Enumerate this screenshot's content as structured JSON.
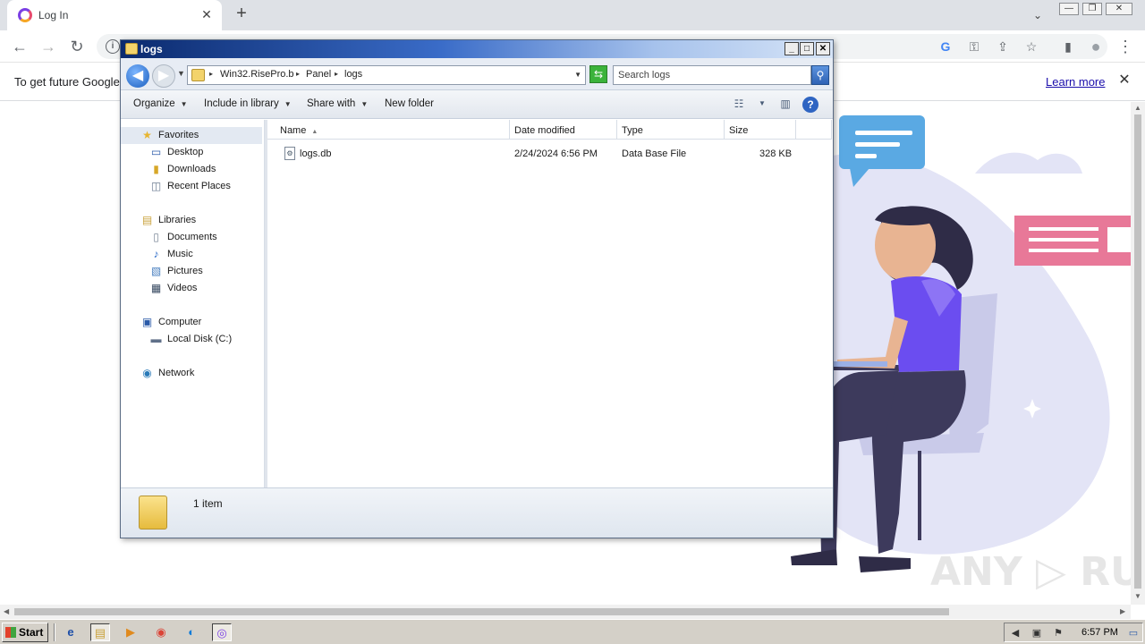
{
  "browser": {
    "tab": {
      "title": "Log In",
      "close": "✕"
    },
    "new_tab": "+",
    "tab_search": "⌄",
    "window_controls": {
      "minimize": "—",
      "restore": "❐",
      "close": "✕"
    },
    "nav": {
      "back": "←",
      "forward": "→",
      "reload": "↻"
    },
    "omnibox": {
      "info_icon": "i"
    },
    "toolbar_icons": {
      "google": "G",
      "key": "⚿",
      "share": "⇪",
      "star": "☆",
      "sidebar": "▮",
      "profile": "●",
      "menu": "⋮"
    },
    "infobar": {
      "text": "To get future Google",
      "link": "Learn more",
      "close": "✕"
    }
  },
  "explorer": {
    "title": "logs",
    "window_buttons": {
      "minimize": "_",
      "maximize": "□",
      "close": "✕"
    },
    "nav": {
      "back": "◀",
      "forward": "▶",
      "history": "▼"
    },
    "breadcrumbs": [
      "Win32.RisePro.b",
      "Panel",
      "logs"
    ],
    "breadcrumb_arrow": "▸",
    "address_dropdown": "▼",
    "refresh": "⇆",
    "search_placeholder": "Search logs",
    "search_icon": "⚲",
    "commands": {
      "organize": "Organize",
      "include": "Include in library",
      "share": "Share with",
      "new_folder": "New folder",
      "dropdown_arrow": "▼",
      "views_icon": "☷",
      "preview_icon": "▥",
      "help": "?"
    },
    "sidebar": {
      "favorites": {
        "label": "Favorites",
        "icon": "★"
      },
      "favorite_items": [
        {
          "label": "Desktop",
          "icon": "▭"
        },
        {
          "label": "Downloads",
          "icon": "▮"
        },
        {
          "label": "Recent Places",
          "icon": "◫"
        }
      ],
      "libraries": {
        "label": "Libraries",
        "icon": "▤"
      },
      "library_items": [
        {
          "label": "Documents",
          "icon": "▯"
        },
        {
          "label": "Music",
          "icon": "♪"
        },
        {
          "label": "Pictures",
          "icon": "▧"
        },
        {
          "label": "Videos",
          "icon": "▦"
        }
      ],
      "computer": {
        "label": "Computer",
        "icon": "▣"
      },
      "computer_items": [
        {
          "label": "Local Disk (C:)",
          "icon": "▬"
        }
      ],
      "network": {
        "label": "Network",
        "icon": "◉"
      }
    },
    "columns": {
      "name": "Name",
      "date": "Date modified",
      "type": "Type",
      "size": "Size",
      "sort_arrow": "▲"
    },
    "files": [
      {
        "name": "logs.db",
        "date": "2/24/2024 6:56 PM",
        "type": "Data Base File",
        "size": "328 KB",
        "icon": "⚙"
      }
    ],
    "status": "1 item"
  },
  "taskbar": {
    "start": "Start",
    "icons": {
      "ie": "e",
      "explorer": "▤",
      "media": "▶",
      "chrome": "◉",
      "edge": "◐",
      "app": "◎"
    },
    "tray_icons": {
      "volume": "◀",
      "network": "▣",
      "flag": "⚑",
      "desktop": "▭"
    },
    "clock": "6:57 PM"
  },
  "colors": {
    "illustration_blob": "#e3e4f6",
    "speech_blue": "#5aa9e3",
    "speech_pink": "#e87898",
    "shirt": "#6b4df0",
    "pants": "#3d3a5c",
    "chair": "#c9cae9"
  }
}
